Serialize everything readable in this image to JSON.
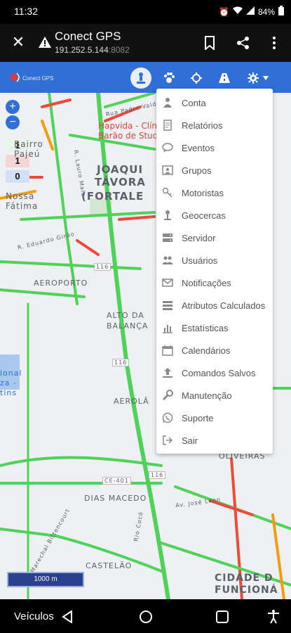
{
  "status": {
    "time": "11:32",
    "battery": "84%"
  },
  "browser": {
    "title": "Conect GPS",
    "url_host": "191.252.5.144",
    "url_port": ":8082"
  },
  "toolbar": {
    "logo_text": "Conect GPS",
    "buttons": [
      "person-pin-icon",
      "paw-icon",
      "crosshair-icon",
      "road-icon",
      "gear-icon"
    ]
  },
  "map": {
    "zoom_in": "+",
    "zoom_out": "−",
    "counts": [
      "1",
      "1",
      "0"
    ],
    "count_colors": [
      "#e9f5e9",
      "#f5d5d5",
      "#cfe0f7"
    ],
    "scale": "1000 m",
    "labels": {
      "joaquim": "JOAQUI",
      "tavora": "TÁVORA",
      "fortaleza": "(FORTALE",
      "aeroporto": "AEROPORTO",
      "alto_da": "ALTO DA",
      "balanca": "BALANÇA",
      "aerola": "AEROLÂ",
      "dias_macedo": "DIAS MACEDO",
      "castelao": "CASTELÃO",
      "oliveiras": "OLIVEIRAS",
      "cidade_dos": "CIDADE D",
      "funcional": "FUNCIONÁ",
      "hapvida1": "Hapvida - Clín",
      "hapvida2": "Barão de Stud",
      "nossa": "Nossa",
      "fatima": "Fátima",
      "rua_padre": "Rua Padre Valdevino",
      "r_lauro": "R. Lauro Maia",
      "r_eduardo": "R. Eduardo Girão",
      "av_jose": "Av. José Leon",
      "av_marechal": "Av. Marechal Bittencourt",
      "rio_cocó": "Rio Cocó",
      "ce401": "CE-401",
      "r116a": "116",
      "r116b": "116",
      "r116c": "116",
      "bairro": "Bairro",
      "pajeu": "Pajeú",
      "cidade_a": "ional",
      "cidade_b": "za -",
      "cidade_c": "tins"
    }
  },
  "menu": {
    "items": [
      {
        "label": "Conta",
        "icon": "person-icon"
      },
      {
        "label": "Relatórios",
        "icon": "report-icon"
      },
      {
        "label": "Eventos",
        "icon": "chat-bubble-icon"
      },
      {
        "label": "Grupos",
        "icon": "groups-icon"
      },
      {
        "label": "Motoristas",
        "icon": "key-icon"
      },
      {
        "label": "Geocercas",
        "icon": "geofence-pin-icon"
      },
      {
        "label": "Servidor",
        "icon": "server-icon"
      },
      {
        "label": "Usuários",
        "icon": "users-icon"
      },
      {
        "label": "Notificações",
        "icon": "envelope-icon"
      },
      {
        "label": "Atributos Calculados",
        "icon": "list-icon"
      },
      {
        "label": "Estatísticas",
        "icon": "bar-chart-icon"
      },
      {
        "label": "Calendários",
        "icon": "calendar-icon"
      },
      {
        "label": "Comandos Salvos",
        "icon": "upload-icon"
      },
      {
        "label": "Manutenção",
        "icon": "wrench-icon"
      },
      {
        "label": "Suporte",
        "icon": "whatsapp-icon"
      },
      {
        "label": "Sair",
        "icon": "logout-icon"
      }
    ]
  },
  "nav": {
    "veiculos": "Veículos"
  }
}
